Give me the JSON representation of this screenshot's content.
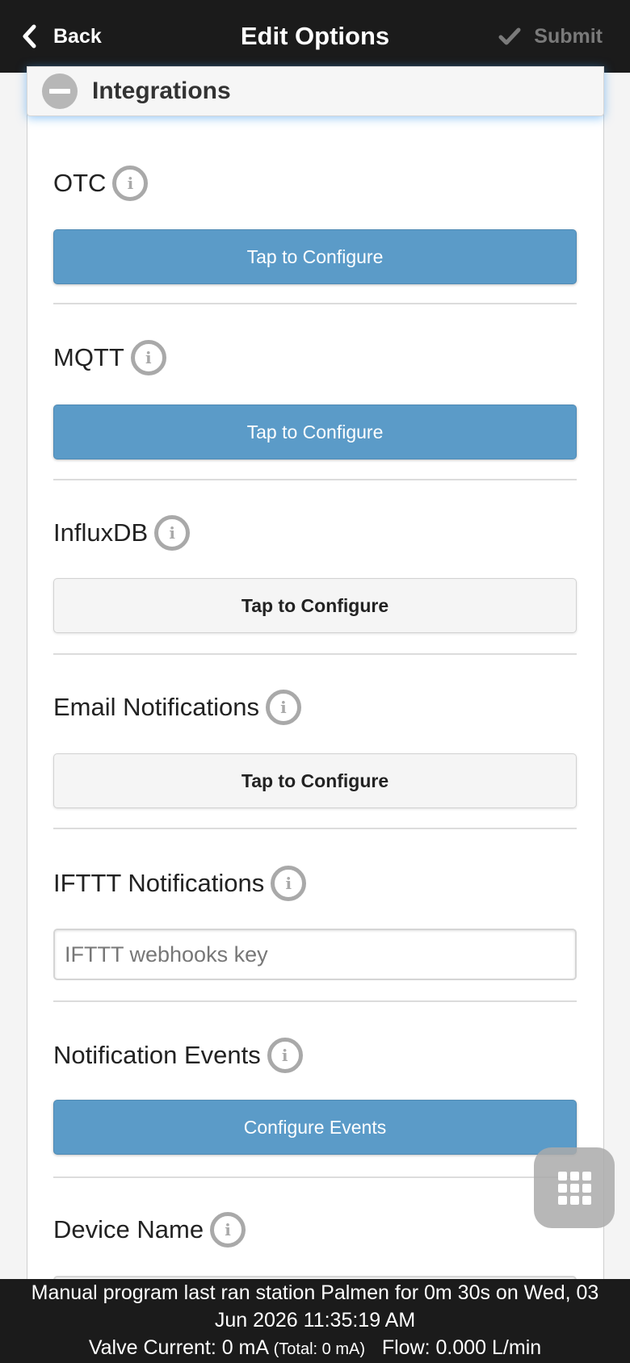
{
  "header": {
    "back_label": "Back",
    "title": "Edit Options",
    "submit_label": "Submit"
  },
  "section": {
    "title": "Integrations"
  },
  "fields": {
    "otc": {
      "label": "OTC",
      "button": "Tap to Configure"
    },
    "mqtt": {
      "label": "MQTT",
      "button": "Tap to Configure"
    },
    "influxdb": {
      "label": "InfluxDB",
      "button": "Tap to Configure"
    },
    "email": {
      "label": "Email Notifications",
      "button": "Tap to Configure"
    },
    "ifttt": {
      "label": "IFTTT Notifications",
      "placeholder": "IFTTT webhooks key"
    },
    "events": {
      "label": "Notification Events",
      "button": "Configure Events"
    },
    "device_name": {
      "label": "Device Name"
    }
  },
  "info_glyph": "i",
  "footer": {
    "line1": "Manual program last ran station Palmen for 0m 30s on Wed, 03",
    "line2": "Jun 2026 11:35:19 AM",
    "valve_current": "Valve Current: 0 mA",
    "total": "(Total: 0 mA)",
    "flow": "Flow: 0.000 L/min"
  },
  "colors": {
    "header_bg": "#1b1b1b",
    "primary_button": "#5b9bc8",
    "secondary_button": "#f5f5f5",
    "focus_glow": "#3898ec"
  },
  "icons": {
    "back": "chevron-left-icon",
    "submit": "check-icon",
    "collapse": "minus-circle-icon",
    "info": "info-icon",
    "menu": "grid-menu-icon"
  }
}
